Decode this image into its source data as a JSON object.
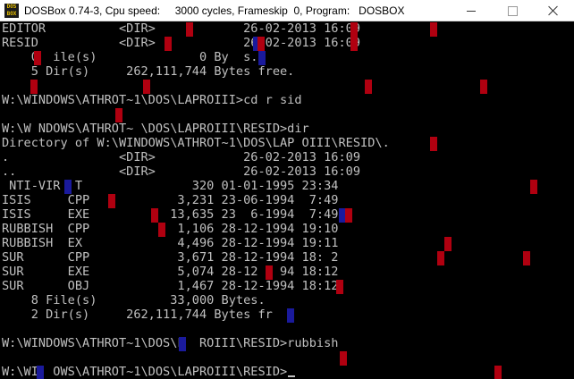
{
  "window": {
    "title": "DOSBox 0.74-3, Cpu speed:     3000 cycles, Frameskip  0, Program:   DOSBOX",
    "icon_label": "DOS BOX",
    "icons": {
      "app": "dosbox-icon",
      "minimize": "minimize-icon",
      "maximize": "maximize-icon",
      "close": "close-icon"
    }
  },
  "colors": {
    "text": "#c0c0c0",
    "background": "#000000",
    "artifact_red": "#b00010",
    "artifact_blue": "#1a1a9c"
  },
  "terminal": {
    "lines": [
      "EDITOR          <DIR>            26-02-2013 16:09",
      "RESID           <DIR>            26-02-2013 16:09",
      "    0  ile(s)              0 By  s.",
      "    5 Dir(s)     262,111,744 Bytes free.",
      "",
      "W:\\WINDOWS\\ATHROT~1\\DOS\\LAPROIII>cd r sid",
      "",
      "W:\\W NDOWS\\ATHROT~ \\DOS\\LAPROIII\\RESID>dir",
      "Directory of W:\\WINDOWS\\ATHROT~1\\DOS\\LAP OIII\\RESID\\.",
      ".               <DIR>            26-02-2013 16:09",
      "..              <DIR>            26-02-2013 16:09",
      " NTI-VIR  T               320 01-01-1995 23:34",
      "ISIS     CPP            3,231 23-06-1994  7:49",
      "ISIS     EXE           13,635 23  6-1994  7:49",
      "RUBBISH  CPP            1,106 28-12-1994 19:10",
      "RUBBISH  EX             4,496 28-12-1994 19:11",
      "SUR      CPP            3,671 28-12-1994 18: 2",
      "SUR      EXE            5,074 28-12   94 18:12",
      "SUR      OBJ            1,467 28-12-1994 18:12",
      "    8 File(s)          33,000 Bytes.",
      "    2 Dir(s)     262,111,744 Bytes fr  .",
      "",
      "W:\\WINDOWS\\ATHROT~1\\DOS\\L  ROIII\\RESID>rubbish",
      "",
      "W:\\WI  OWS\\ATHROT~1\\DOS\\LAPROIII\\RESID>"
    ]
  }
}
